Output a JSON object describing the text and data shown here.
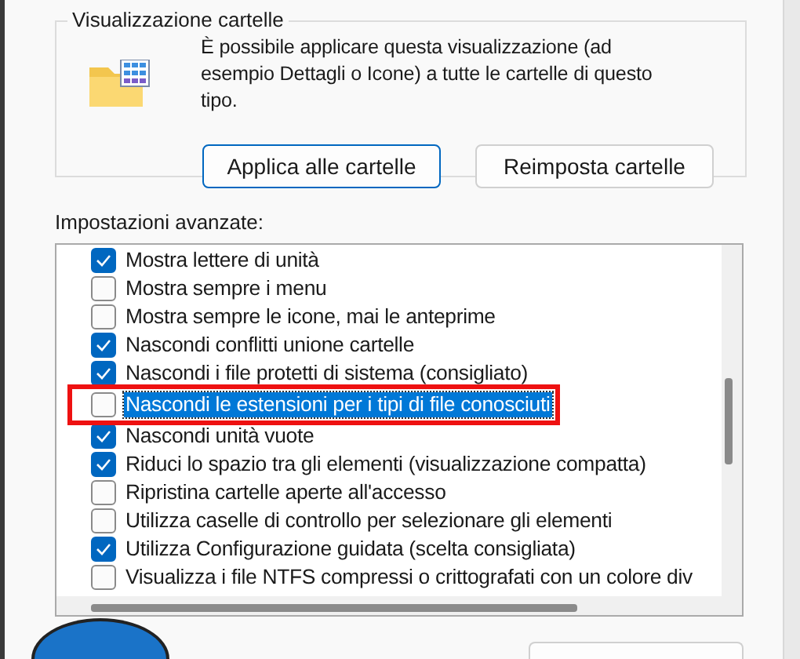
{
  "folder_views": {
    "title": "Visualizzazione cartelle",
    "description": "È possibile applicare questa visualizzazione (ad esempio Dettagli o Icone) a tutte le cartelle di questo tipo.",
    "buttons": [
      {
        "label": "Applica alle cartelle",
        "default": true
      },
      {
        "label": "Reimposta cartelle",
        "default": false
      }
    ]
  },
  "advanced": {
    "label": "Impostazioni avanzate:",
    "items": [
      {
        "label": "Mostra lettere di unità",
        "checked": true,
        "selected": false,
        "annotated": false
      },
      {
        "label": "Mostra sempre i menu",
        "checked": false,
        "selected": false,
        "annotated": false
      },
      {
        "label": "Mostra sempre le icone, mai le anteprime",
        "checked": false,
        "selected": false,
        "annotated": false
      },
      {
        "label": "Nascondi conflitti unione cartelle",
        "checked": true,
        "selected": false,
        "annotated": false
      },
      {
        "label": "Nascondi i file protetti di sistema (consigliato)",
        "checked": true,
        "selected": false,
        "annotated": false
      },
      {
        "label": "Nascondi le estensioni per i tipi di file conosciuti",
        "checked": false,
        "selected": true,
        "annotated": true
      },
      {
        "label": "Nascondi unità vuote",
        "checked": true,
        "selected": false,
        "annotated": false
      },
      {
        "label": "Riduci lo spazio tra gli elementi (visualizzazione compatta)",
        "checked": true,
        "selected": false,
        "annotated": false
      },
      {
        "label": "Ripristina cartelle aperte all'accesso",
        "checked": false,
        "selected": false,
        "annotated": false
      },
      {
        "label": "Utilizza caselle di controllo per selezionare gli elementi",
        "checked": false,
        "selected": false,
        "annotated": false
      },
      {
        "label": "Utilizza Configurazione guidata (scelta consigliata)",
        "checked": true,
        "selected": false,
        "annotated": false
      },
      {
        "label": "Visualizza i file NTFS compressi o crittografati con un colore div",
        "checked": false,
        "selected": false,
        "annotated": false
      }
    ]
  }
}
